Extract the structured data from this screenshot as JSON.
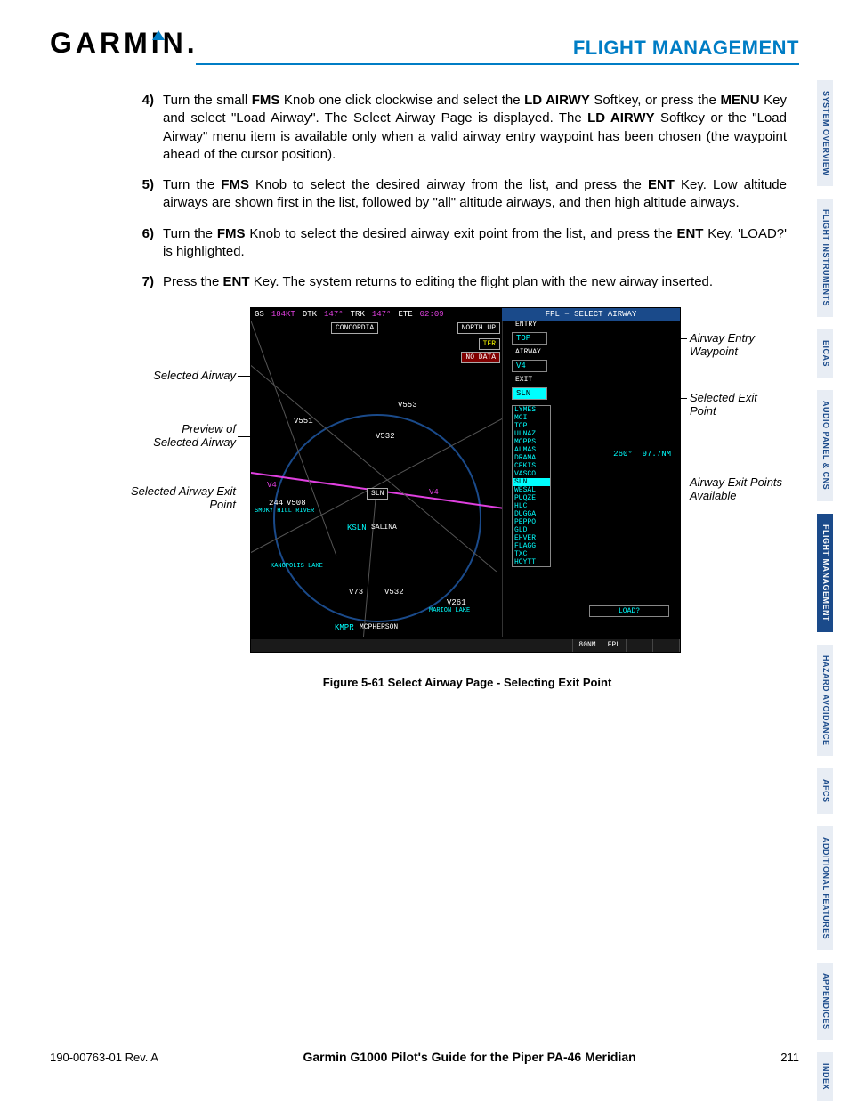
{
  "header": {
    "logo_text": "GARMIN",
    "logo_dot": ".",
    "section_title": "FLIGHT MANAGEMENT"
  },
  "steps": [
    {
      "num": "4)",
      "parts": [
        "Turn the small ",
        {
          "b": "FMS"
        },
        " Knob one click clockwise and select the ",
        {
          "b": "LD AIRWY"
        },
        " Softkey, or press the ",
        {
          "b": "MENU"
        },
        " Key and select \"Load Airway\". The Select Airway Page is displayed.  The ",
        {
          "b": "LD AIRWY"
        },
        " Softkey or the \"Load Airway\" menu item is available only when a valid airway entry waypoint has been chosen (the waypoint ahead of the cursor position)."
      ]
    },
    {
      "num": "5)",
      "parts": [
        "Turn the ",
        {
          "b": "FMS"
        },
        " Knob to select the desired airway from the list, and press the ",
        {
          "b": "ENT"
        },
        " Key.  Low altitude airways are shown first in the list, followed by \"all\" altitude airways, and then high altitude airways."
      ]
    },
    {
      "num": "6)",
      "parts": [
        "Turn the ",
        {
          "b": "FMS"
        },
        " Knob to select the desired airway exit point from the list, and press the ",
        {
          "b": "ENT"
        },
        " Key. 'LOAD?' is highlighted."
      ]
    },
    {
      "num": "7)",
      "parts": [
        "Press the ",
        {
          "b": "ENT"
        },
        " Key. The system returns to editing the flight plan with the new airway inserted."
      ]
    }
  ],
  "screen": {
    "top": {
      "gs": "GS",
      "gsv": "184KT",
      "dtk": "DTK",
      "dtkv": "147°",
      "trk": "TRK",
      "trkv": "147°",
      "ete": "ETE",
      "etev": "02:09",
      "fpl": "FPL − SELECT AIRWAY"
    },
    "pills": {
      "concordia": "CONCORDIA",
      "northup": "NORTH UP",
      "tfr": "TFR",
      "nodata": "NO DATA"
    },
    "waypoints": {
      "v551": "V551",
      "v553": "V553",
      "v532": "V532",
      "sln": "SLN",
      "v4": "V4",
      "ksln": "KSLN",
      "salina": "SALINA",
      "kmpr": "KMPR",
      "mcp": "MCPHERSON",
      "v73": "V73",
      "v532b": "V532",
      "v261": "V261",
      "marion": "MARION LAKE",
      "kan": "KANOPOLIS LAKE",
      "smoky": "SMOKY HILL RIVER",
      "v508": "V508",
      "num244": "244"
    },
    "panel": {
      "entry_lbl": "ENTRY",
      "entry": "TOP",
      "airwy_lbl": "AIRWAY",
      "airwy": "V4",
      "exit_lbl": "EXIT",
      "exit": "SLN",
      "list": [
        "LYMES",
        "MCI",
        "TOP",
        "ULNAZ",
        "MOPPS",
        "ALMAS",
        "DRAMA",
        "CEKIS",
        "VASCO",
        "SLN",
        "WESAL",
        "PUQZE",
        "HLC",
        "DUGGA",
        "PEPPO",
        "GLD",
        "EHVER",
        "FLAGG",
        "TXC",
        "HOYTT"
      ],
      "selected_idx": 9,
      "brg": "260°",
      "dist": "97.7NM",
      "load": "LOAD?"
    },
    "bottom": {
      "scale": "80NM",
      "fpl": "FPL"
    }
  },
  "callouts": {
    "left1": "Selected Airway",
    "left2a": "Preview of",
    "left2b": "Selected Airway",
    "left3a": "Selected Airway Exit",
    "left3b": "Point",
    "right1": "Airway Entry Waypoint",
    "right2": "Selected Exit Point",
    "right3a": "Airway Exit Points",
    "right3b": "Available"
  },
  "figure_caption": "Figure 5-61  Select Airway Page - Selecting Exit Point",
  "tabs": [
    {
      "label": "SYSTEM\nOVERVIEW",
      "active": false
    },
    {
      "label": "FLIGHT\nINSTRUMENTS",
      "active": false
    },
    {
      "label": "EICAS",
      "active": false
    },
    {
      "label": "AUDIO PANEL\n& CNS",
      "active": false
    },
    {
      "label": "FLIGHT\nMANAGEMENT",
      "active": true
    },
    {
      "label": "HAZARD\nAVOIDANCE",
      "active": false
    },
    {
      "label": "AFCS",
      "active": false
    },
    {
      "label": "ADDITIONAL\nFEATURES",
      "active": false
    },
    {
      "label": "APPENDICES",
      "active": false
    },
    {
      "label": "INDEX",
      "active": false
    }
  ],
  "footer": {
    "left": "190-00763-01  Rev. A",
    "mid": "Garmin G1000 Pilot's Guide for the Piper PA-46 Meridian",
    "right": "211"
  }
}
